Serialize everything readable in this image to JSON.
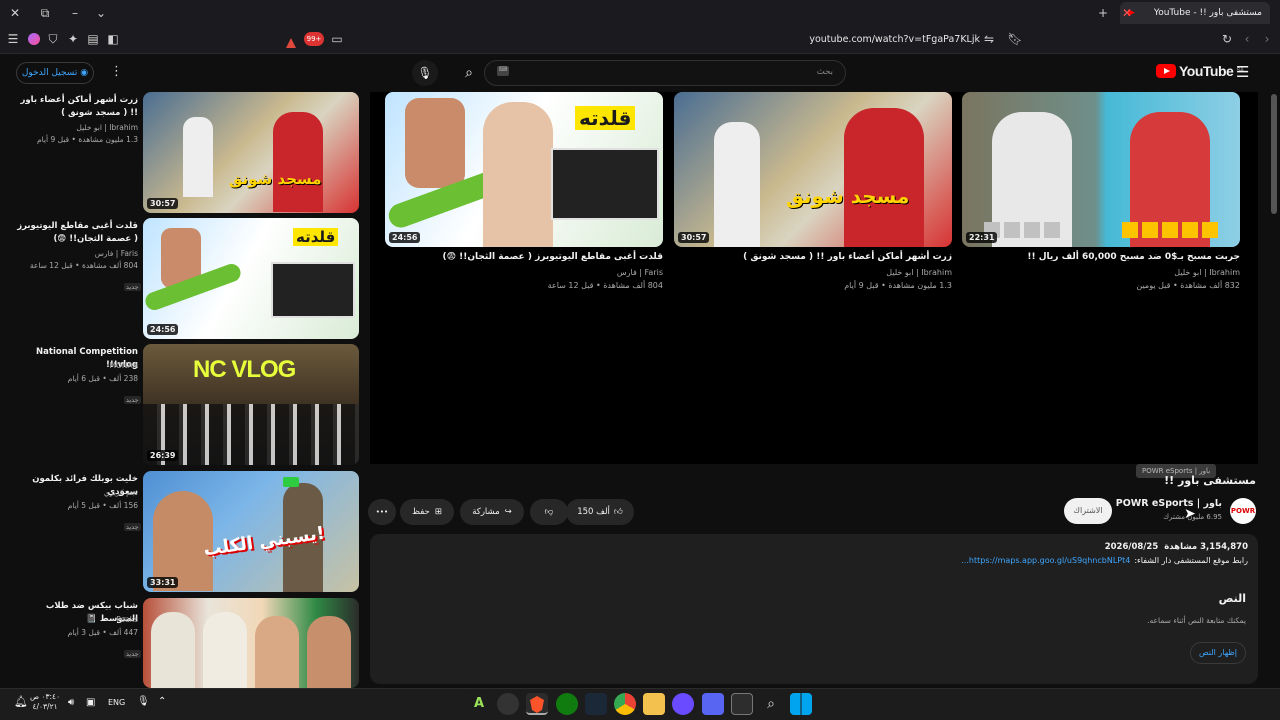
{
  "browser": {
    "tab_title": "مستشفى باور !! - YouTube",
    "url": "youtube.com/watch?v=tFgaPa7KLjk",
    "badge_count": "99+"
  },
  "header": {
    "signin_label": "تسجيل الدخول",
    "logo_text": "YouTube",
    "logo_region": "SA",
    "search_placeholder": "بحث"
  },
  "sidebar": [
    {
      "title": "زرت أشهر أماكن أعضاء باور !! ( مسجد شونق )",
      "channel": "Ibrahim | ابو خليل",
      "meta": "1.3 مليون مشاهدة • قبل 9 أيام",
      "duration": "30:57",
      "thumb_text": "مسجد شونق"
    },
    {
      "title": "قلدت أغبى مقاطع اليوتيوبرز ( عصمة الثجان!! 😨)",
      "channel": "Faris | فارس",
      "meta": "804 ألف مشاهدة • قبل 12 ساعة",
      "badge": "جديد",
      "duration": "24:56",
      "thumb_text": "قلدته"
    },
    {
      "title": "National Competition vlog!!!",
      "channel": "MONAA",
      "meta": "238 ألف • قبل 6 أيام",
      "badge": "جديد",
      "duration": "26:39",
      "thumb_text": "NC VLOG"
    },
    {
      "title": "خليت بوبلك فرائد بكلمون سعودي",
      "channel": "نجم كريزي",
      "meta": "156 ألف • قبل 5 أيام",
      "badge": "جديد",
      "duration": "33:31",
      "thumb_text": "يسبني الكلب!"
    },
    {
      "title": "شباب بيكس ضد طلاب المتوسط 📓",
      "channel": "Peaks",
      "meta": "447 ألف • قبل 3 أيام",
      "badge": "جديد",
      "duration": "",
      "thumb_text": ""
    }
  ],
  "endscreen": [
    {
      "title": "قلدت أغبى مقاطع اليوتيوبرز ( عصمة الثجان!! 😨)",
      "channel": "Faris | فارس",
      "meta": "804 ألف مشاهدة • قبل 12 ساعة",
      "duration": "24:56",
      "thumb_text": "قلدته"
    },
    {
      "title": "زرت أشهر أماكن أعضاء باور !! ( مسجد شونق )",
      "channel": "Ibrahim | ابو خليل",
      "meta": "1.3 مليون مشاهدة • قبل 9 أيام",
      "duration": "30:57",
      "thumb_text": "مسجد شونق"
    },
    {
      "title": "جربت مسبح بـ$0 ضد مسبح 60,000 ألف ريال !!",
      "channel": "Ibrahim | ابو خليل",
      "meta": "832 ألف مشاهدة • قبل يومين",
      "duration": "22:31",
      "thumb_text": ""
    }
  ],
  "video": {
    "title": "مستشفى باور !!",
    "tooltip": "POWR eSports | باور",
    "channel_name": "POWR eSports | باور",
    "subscribers": "6.95 مليون مشترك",
    "subscribe_label": "الاشتراك",
    "likes": "150 ألف",
    "share_label": "مشاركة",
    "save_label": "حفظ",
    "more_label": "•••"
  },
  "description": {
    "views": "3,154,870 مشاهدة",
    "date": "2026/08/25",
    "text": "رابط موقع المستشفى دار الشفاء:",
    "link": "https://maps.app.goo.gl/uS9qhncbNLPt4...",
    "transcript_heading": "النص",
    "transcript_hint": "يمكنك متابعة النص أثناء سماعه.",
    "transcript_button": "إظهار النص"
  },
  "taskbar": {
    "time": "٠٣:٤٠ ص",
    "date": "٤/٠٣/٢١",
    "lang": "ENG"
  },
  "colors": {
    "youtube_red": "#ff0000",
    "link_blue": "#3ea6ff",
    "background": "#0f0f0f"
  }
}
